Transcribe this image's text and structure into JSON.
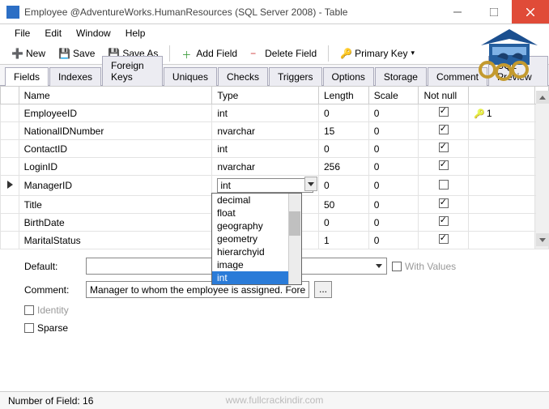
{
  "title": "Employee @AdventureWorks.HumanResources (SQL Server 2008) - Table",
  "menu": {
    "file": "File",
    "edit": "Edit",
    "window": "Window",
    "help": "Help"
  },
  "toolbar": {
    "new": "New",
    "save": "Save",
    "saveas": "Save As",
    "addfield": "Add Field",
    "deletefield": "Delete Field",
    "primarykey": "Primary Key"
  },
  "tabs": {
    "fields": "Fields",
    "indexes": "Indexes",
    "foreignkeys": "Foreign Keys",
    "uniques": "Uniques",
    "checks": "Checks",
    "triggers": "Triggers",
    "options": "Options",
    "storage": "Storage",
    "comment": "Comment",
    "sqlpreview": "SQL Preview"
  },
  "grid": {
    "headers": {
      "name": "Name",
      "type": "Type",
      "length": "Length",
      "scale": "Scale",
      "notnull": "Not null"
    },
    "rows": [
      {
        "name": "EmployeeID",
        "type": "int",
        "length": "0",
        "scale": "0",
        "notnull": true,
        "pk": "1",
        "active": false
      },
      {
        "name": "NationalIDNumber",
        "type": "nvarchar",
        "length": "15",
        "scale": "0",
        "notnull": true,
        "pk": "",
        "active": false
      },
      {
        "name": "ContactID",
        "type": "int",
        "length": "0",
        "scale": "0",
        "notnull": true,
        "pk": "",
        "active": false
      },
      {
        "name": "LoginID",
        "type": "nvarchar",
        "length": "256",
        "scale": "0",
        "notnull": true,
        "pk": "",
        "active": false
      },
      {
        "name": "ManagerID",
        "type": "int",
        "length": "0",
        "scale": "0",
        "notnull": false,
        "pk": "",
        "active": true
      },
      {
        "name": "Title",
        "type": "",
        "length": "50",
        "scale": "0",
        "notnull": true,
        "pk": "",
        "active": false
      },
      {
        "name": "BirthDate",
        "type": "",
        "length": "0",
        "scale": "0",
        "notnull": true,
        "pk": "",
        "active": false
      },
      {
        "name": "MaritalStatus",
        "type": "",
        "length": "1",
        "scale": "0",
        "notnull": true,
        "pk": "",
        "active": false
      }
    ]
  },
  "typedropdown": {
    "value": "int",
    "options": [
      "decimal",
      "float",
      "geography",
      "geometry",
      "hierarchyid",
      "image",
      "int"
    ],
    "selected": "int"
  },
  "form": {
    "default_label": "Default:",
    "default_value": "",
    "comment_label": "Comment:",
    "comment_value": "Manager to whom the employee is assigned. Foreign Ke",
    "identity_label": "Identity",
    "identity_checked": false,
    "identity_disabled": true,
    "sparse_label": "Sparse",
    "sparse_checked": false,
    "withvalues_label": "With Values",
    "withvalues_checked": false,
    "withvalues_disabled": true,
    "ellipsis": "..."
  },
  "status": {
    "field_count": "Number of Field: 16"
  },
  "watermark": "www.fullcrackindir.com"
}
